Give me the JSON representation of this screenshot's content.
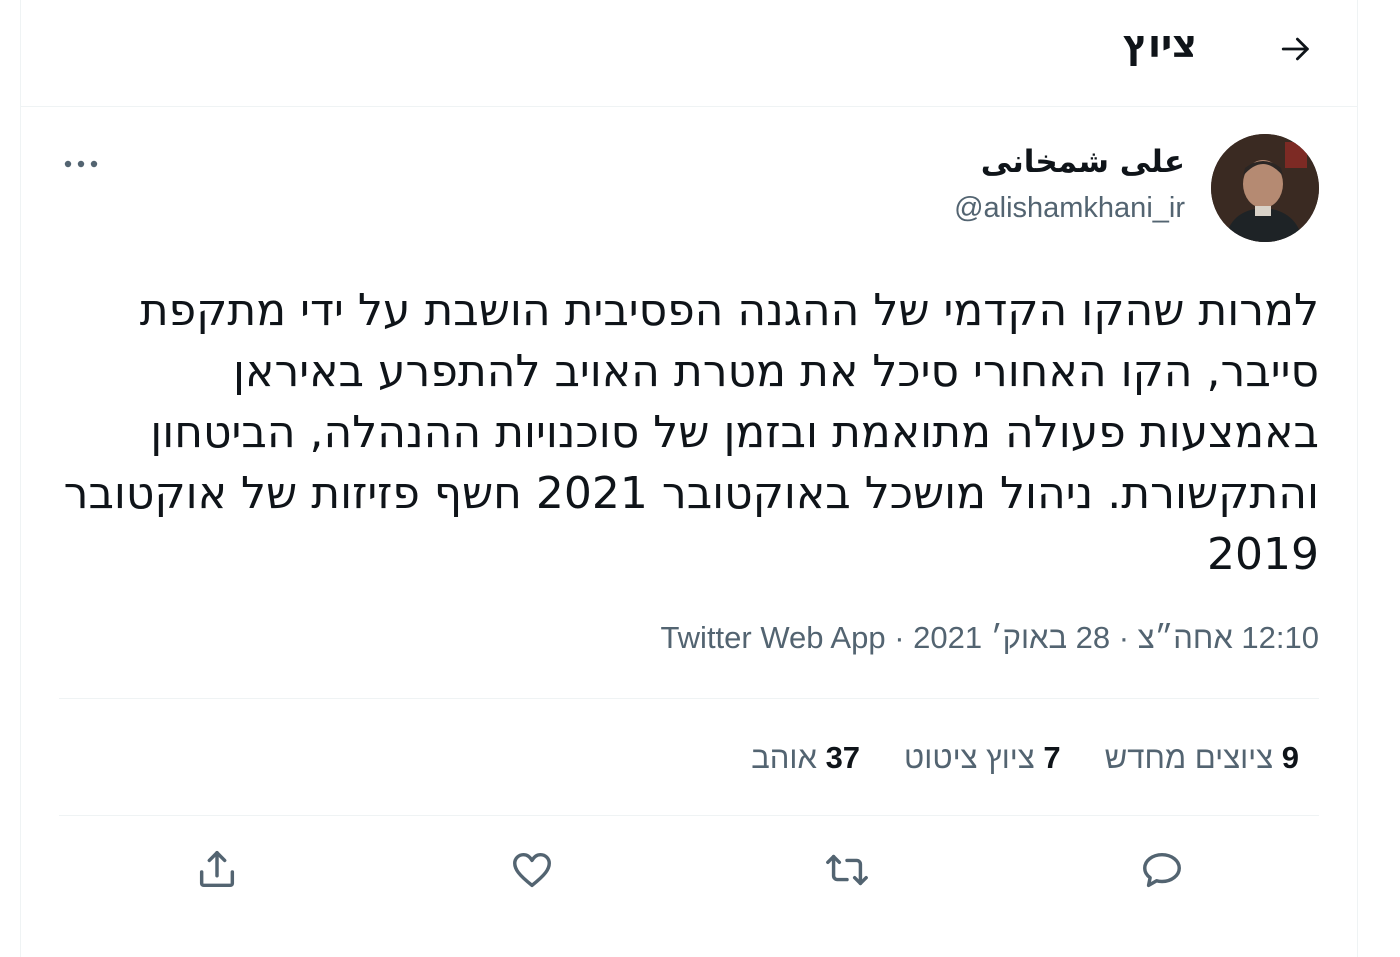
{
  "header": {
    "title": "ציוץ",
    "back_icon": "arrow-right-icon"
  },
  "tweet": {
    "author": {
      "display_name": "علی شمخانی",
      "handle": "@alishamkhani_ir",
      "avatar": "avatar-photo"
    },
    "text": "למרות שהקו הקדמי של ההגנה הפסיבית הושבת על ידי מתקפת סייבר, הקו האחורי סיכל את מטרת האויב להתפרע באיראן באמצעות פעולה מתואמת ובזמן של סוכנויות ההנהלה, הביטחון והתקשורת. ניהול מושכל באוקטובר 2021 חשף פזיזות של אוקטובר 2019",
    "time": "12:10 אחה״צ",
    "separator": "·",
    "date": "28 באוק׳ 2021",
    "source": "Twitter Web App"
  },
  "stats": {
    "retweets_count": "9",
    "retweets_label": "ציוצים מחדש",
    "quotes_count": "7",
    "quotes_label": "ציוץ ציטוט",
    "likes_count": "37",
    "likes_label": "אוהב"
  },
  "actions": {
    "reply_icon": "reply-icon",
    "retweet_icon": "retweet-icon",
    "like_icon": "heart-icon",
    "share_icon": "share-icon"
  },
  "colors": {
    "text": "#0f1419",
    "secondary": "#536471",
    "border": "#eff3f4"
  }
}
